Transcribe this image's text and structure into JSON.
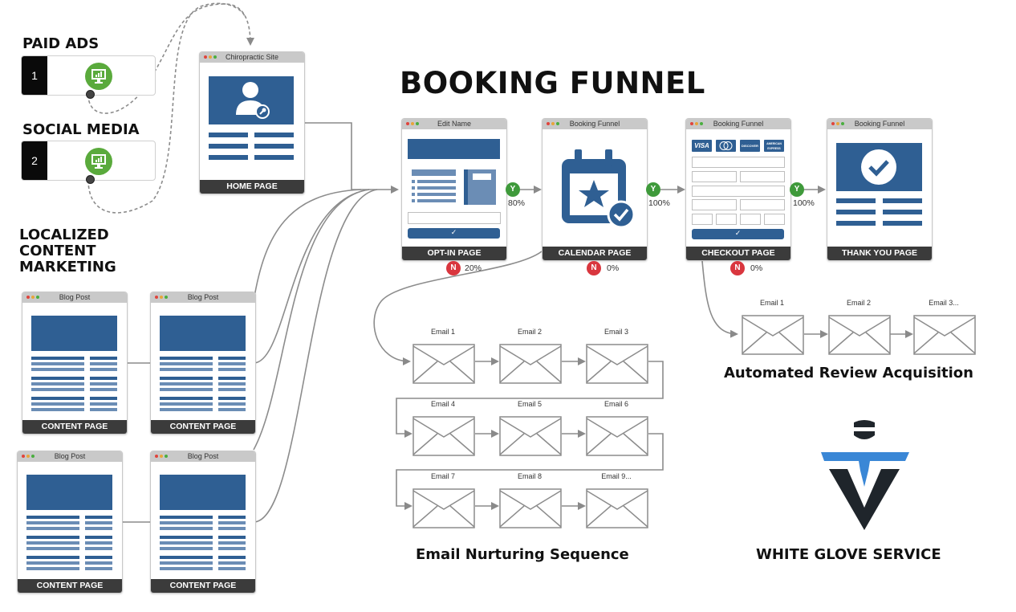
{
  "title": "BOOKING FUNNEL",
  "colors": {
    "blue": "#2f5f93",
    "green": "#5aaa3c",
    "red": "#d9363e",
    "dark": "#3b3b3b",
    "accent_light_blue": "#3a87d6"
  },
  "sources": {
    "paid_ads": {
      "heading": "PAID ADS",
      "number": "1",
      "icon": "monitor-chart-icon"
    },
    "social_media": {
      "heading": "SOCIAL MEDIA",
      "number": "2",
      "icon": "monitor-chart-icon"
    },
    "content_marketing": {
      "heading_lines": [
        "LOCALIZED",
        "CONTENT",
        "MARKETING"
      ]
    }
  },
  "home": {
    "window_title": "Chiropractic Site",
    "footer": "HOME PAGE",
    "icon": "user-key-icon"
  },
  "content_pages": [
    {
      "window_title": "Blog Post",
      "footer": "CONTENT PAGE"
    },
    {
      "window_title": "Blog Post",
      "footer": "CONTENT PAGE"
    },
    {
      "window_title": "Blog Post",
      "footer": "CONTENT PAGE"
    },
    {
      "window_title": "Blog Post",
      "footer": "CONTENT PAGE"
    }
  ],
  "funnel": [
    {
      "window_title": "Edit Name",
      "footer": "OPT-IN PAGE",
      "yes": {
        "label": "Y",
        "pct": "80%"
      },
      "no": {
        "label": "N",
        "pct": "20%"
      }
    },
    {
      "window_title": "Booking Funnel",
      "footer": "CALENDAR PAGE",
      "yes": {
        "label": "Y",
        "pct": "100%"
      },
      "no": {
        "label": "N",
        "pct": "0%"
      }
    },
    {
      "window_title": "Booking Funnel",
      "footer": "CHECKOUT PAGE",
      "yes": {
        "label": "Y",
        "pct": "100%"
      },
      "no": {
        "label": "N",
        "pct": "0%"
      },
      "cards": [
        "VISA",
        "MC",
        "DISCOVER",
        "AMEX"
      ]
    },
    {
      "window_title": "Booking Funnel",
      "footer": "THANK YOU PAGE"
    }
  ],
  "nurture": {
    "title": "Email Nurturing Sequence",
    "emails": [
      "Email 1",
      "Email 2",
      "Email 3",
      "Email 4",
      "Email 5",
      "Email 6",
      "Email 7",
      "Email 8",
      "Email 9..."
    ]
  },
  "review": {
    "title": "Automated Review Acquisition",
    "emails": [
      "Email 1",
      "Email 2",
      "Email 3..."
    ]
  },
  "brand": {
    "name": "WHITE GLOVE SERVICE"
  }
}
